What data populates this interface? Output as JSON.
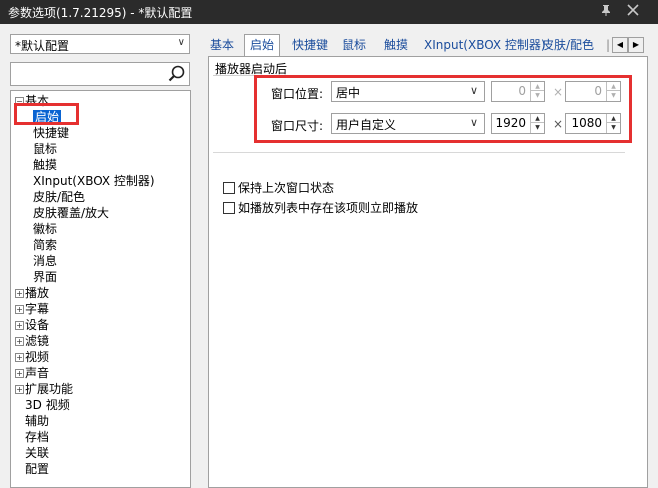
{
  "window": {
    "title": "参数选项(1.7.21295) - *默认配置",
    "pin_icon": "pin-icon",
    "close_icon": "close-icon"
  },
  "sidebar": {
    "profile": "*默认配置",
    "search_placeholder": "",
    "tree": [
      {
        "label": "基本",
        "level": 0,
        "expander": "−"
      },
      {
        "label": "启始",
        "level": 1,
        "selected": true
      },
      {
        "label": "快捷键",
        "level": 1
      },
      {
        "label": "鼠标",
        "level": 1
      },
      {
        "label": "触摸",
        "level": 1
      },
      {
        "label": "XInput(XBOX 控制器)",
        "level": 1
      },
      {
        "label": "皮肤/配色",
        "level": 1
      },
      {
        "label": "皮肤覆盖/放大",
        "level": 1
      },
      {
        "label": "徽标",
        "level": 1
      },
      {
        "label": "简索",
        "level": 1
      },
      {
        "label": "消息",
        "level": 1
      },
      {
        "label": "界面",
        "level": 1
      },
      {
        "label": "播放",
        "level": 0,
        "expander": "+"
      },
      {
        "label": "字幕",
        "level": 0,
        "expander": "+"
      },
      {
        "label": "设备",
        "level": 0,
        "expander": "+"
      },
      {
        "label": "滤镜",
        "level": 0,
        "expander": "+"
      },
      {
        "label": "视频",
        "level": 0,
        "expander": "+"
      },
      {
        "label": "声音",
        "level": 0,
        "expander": "+"
      },
      {
        "label": "扩展功能",
        "level": 0,
        "expander": "+"
      },
      {
        "label": "3D 视频",
        "level": 0
      },
      {
        "label": "辅助",
        "level": 0
      },
      {
        "label": "存档",
        "level": 0
      },
      {
        "label": "关联",
        "level": 0
      },
      {
        "label": "配置",
        "level": 0
      }
    ]
  },
  "tabs": [
    "基本",
    "启始",
    "快捷键",
    "鼠标",
    "触摸",
    "XInput(XBOX 控制器)",
    "皮肤/配色",
    "|"
  ],
  "active_tab": "启始",
  "page": {
    "group_title": "播放器启动后",
    "window_position": {
      "label": "窗口位置:",
      "value": "居中",
      "x": "0",
      "y": "0"
    },
    "window_size": {
      "label": "窗口尺寸:",
      "value": "用户自定义",
      "width": "1920",
      "height": "1080"
    },
    "times": "×",
    "checkboxes": [
      {
        "label": "保持上次窗口状态",
        "checked": false
      },
      {
        "label": "如播放列表中存在该项则立即播放",
        "checked": false
      }
    ]
  },
  "colors": {
    "highlight": "#e53030",
    "selection": "#0a64d2",
    "tab_text": "#1a4c9c"
  }
}
